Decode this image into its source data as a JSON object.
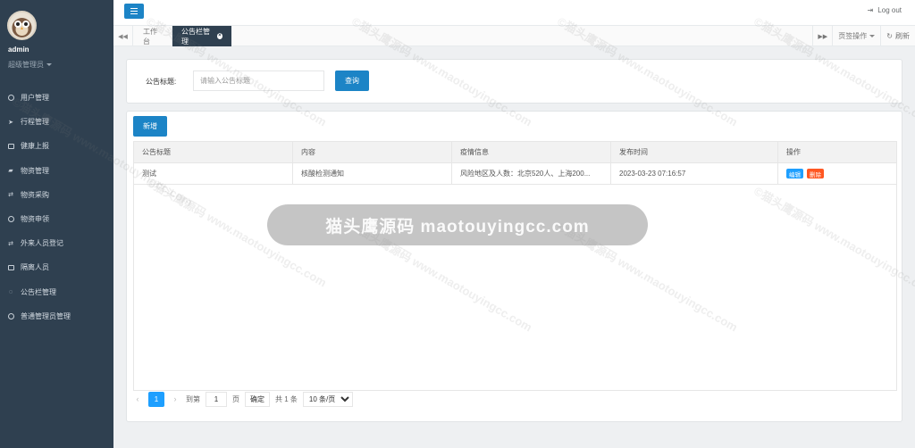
{
  "sidebar": {
    "user_name": "admin",
    "user_role": "超级管理员",
    "items": [
      {
        "label": "用户管理",
        "icon": "user-circle-icon"
      },
      {
        "label": "行程管理",
        "icon": "location-arrow-icon"
      },
      {
        "label": "健康上报",
        "icon": "calendar-icon"
      },
      {
        "label": "物资管理",
        "icon": "car-icon"
      },
      {
        "label": "物资采购",
        "icon": "random-icon"
      },
      {
        "label": "物资申领",
        "icon": "clock-icon"
      },
      {
        "label": "外来人员登记",
        "icon": "random-icon"
      },
      {
        "label": "隔离人员",
        "icon": "address-card-icon"
      },
      {
        "label": "公告栏管理",
        "icon": "comment-icon"
      },
      {
        "label": "普通管理员管理",
        "icon": "user-circle-icon"
      }
    ]
  },
  "topbar": {
    "logout_label": "Log out"
  },
  "tabs": {
    "items": [
      "工作台",
      "公告栏管理"
    ],
    "page_ops_label": "页签操作",
    "refresh_label": "刷新"
  },
  "search": {
    "label": "公告标题:",
    "placeholder": "请输入公告标题",
    "button_label": "查询"
  },
  "table": {
    "add_label": "新增",
    "columns": [
      "公告标题",
      "内容",
      "疫情信息",
      "发布时间",
      "操作"
    ],
    "rows": [
      {
        "title": "测试",
        "content": "核酸检测通知",
        "epidemic_info": "风险地区及人数：北京520人、上海200...",
        "publish_time": "2023-03-23 07:16:57",
        "edit_label": "编辑",
        "delete_label": "删除"
      }
    ]
  },
  "pager": {
    "current_page": "1",
    "goto_label": "到第",
    "goto_value": "1",
    "page_unit": "页",
    "confirm_label": "确定",
    "total_label": "共 1 条",
    "page_size": "10 条/页"
  },
  "watermark": {
    "banner": "猫头鹰源码 maotouyingcc.com",
    "tile": "©猫头鹰源码 www.maotouyingcc.com"
  },
  "colors": {
    "sidebar_bg": "#2f4050",
    "primary": "#1c84c6",
    "edit": "#1e9fff",
    "delete": "#ff5722"
  }
}
